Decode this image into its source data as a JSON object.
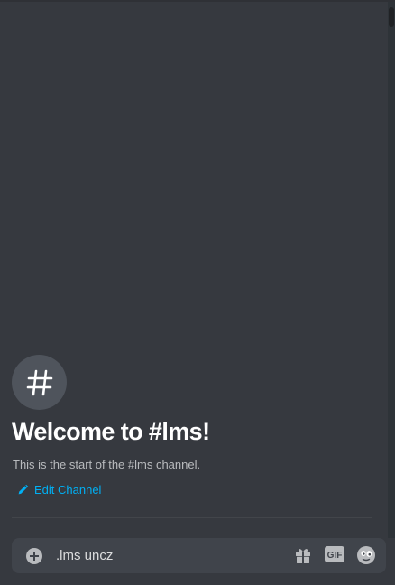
{
  "channel": {
    "hash_symbol": "#",
    "welcome_title": "Welcome to #lms!",
    "subtitle": "This is the start of the #lms channel.",
    "edit_label": "Edit Channel"
  },
  "composer": {
    "input_value": ".lms uncz",
    "gif_label": "GIF"
  },
  "icons": {
    "add": "plus-circle-icon",
    "edit": "pencil-icon",
    "gift": "gift-icon",
    "gif": "gif-icon",
    "emoji": "emoji-icon"
  },
  "colors": {
    "background": "#36393f",
    "composer": "#40444b",
    "link": "#00b0f4",
    "title": "#ffffff",
    "subtitle": "#b9bbbe",
    "icon": "#b9bbbe"
  }
}
